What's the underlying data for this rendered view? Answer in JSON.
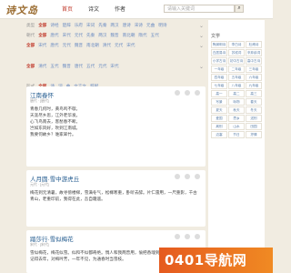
{
  "logo": "诗文岛",
  "nav": [
    "首页",
    "诗文",
    "作者"
  ],
  "search_placeholder": "请输入关键词",
  "search_btn": "⌕",
  "filters": [
    {
      "label": "类型",
      "opts": [
        "全部",
        "诗经",
        "楚辞",
        "乐府",
        "宋词",
        "先秦",
        "两汉",
        "唐诗",
        "宋诗",
        "元曲",
        "明诗",
        "小说"
      ]
    },
    {
      "label": "朝代",
      "opts": [
        "全部",
        "唐代",
        "宋代",
        "元代",
        "先秦",
        "两汉",
        "魏晋",
        "南北朝",
        "隋代",
        "五代",
        "金朝",
        "明代"
      ]
    },
    {
      "label": "形式",
      "opts": [
        "全部",
        "诗",
        "词",
        "曲",
        "文言文",
        "辞赋"
      ]
    }
  ],
  "filters_extra": {
    "row2": [
      "全部",
      "宋代",
      "唐代",
      "元代",
      "魏晋",
      "南北朝",
      "清代",
      "元代",
      "宋代"
    ],
    "row3": [
      "全部",
      "清代",
      "五代",
      "魏晋",
      "唐代",
      "五代",
      "元代",
      "宋代"
    ]
  },
  "cards": [
    {
      "title": "江南春怀",
      "meta": "唐代 · [唐代]",
      "body": [
        "青春几何时，黄鸟鸣不歇。",
        "天涯尽乡思，江外老华发。",
        "心飞鸟南去，客愁春不断。",
        "岂如东风好，吹到江南城。",
        "我要何故乡？谁家翠竹。"
      ]
    },
    {
      "title": "人月圆·雪中游虎丘",
      "meta": "元代 · [元代]",
      "body": [
        "梅花到元清暑，故寻傍楼梯，雪满冬气，松橼寒重，卧听去醉。片仁雷用，一尺重影，千古青山，老重印前，我得在此，吾自霜遥。"
      ]
    },
    {
      "title": "踏莎行·雪似梅花",
      "meta": "宋代 · [宋代]",
      "body": [
        "雪似梅花，梅花似雪。似和不似都奇绝。惆人和我两曾用，偷把香魂到心中仁。",
        "记得去年，对梅吟芳，一年不见，为通春时当雪枝。"
      ]
    }
  ],
  "sidebar": {
    "title": "文学",
    "items": [
      "陶渊明诗",
      "李白诗",
      "杜甫诗",
      "白居易诗",
      "苏轼词",
      "辛弃疾词",
      "小学古诗",
      "初中古诗",
      "高中古诗",
      "一年级",
      "二年级",
      "三年级",
      "四年级",
      "五年级",
      "六年级",
      "七年级",
      "八年级",
      "九年级",
      "高一",
      "高二",
      "高三",
      "写景",
      "咏物",
      "春天",
      "夏天",
      "秋天",
      "冬天",
      "爱国",
      "思乡",
      "送别",
      "离别",
      "山水",
      "田园",
      "边塞",
      "节日",
      "抒情"
    ]
  },
  "banner": "0401导航网"
}
